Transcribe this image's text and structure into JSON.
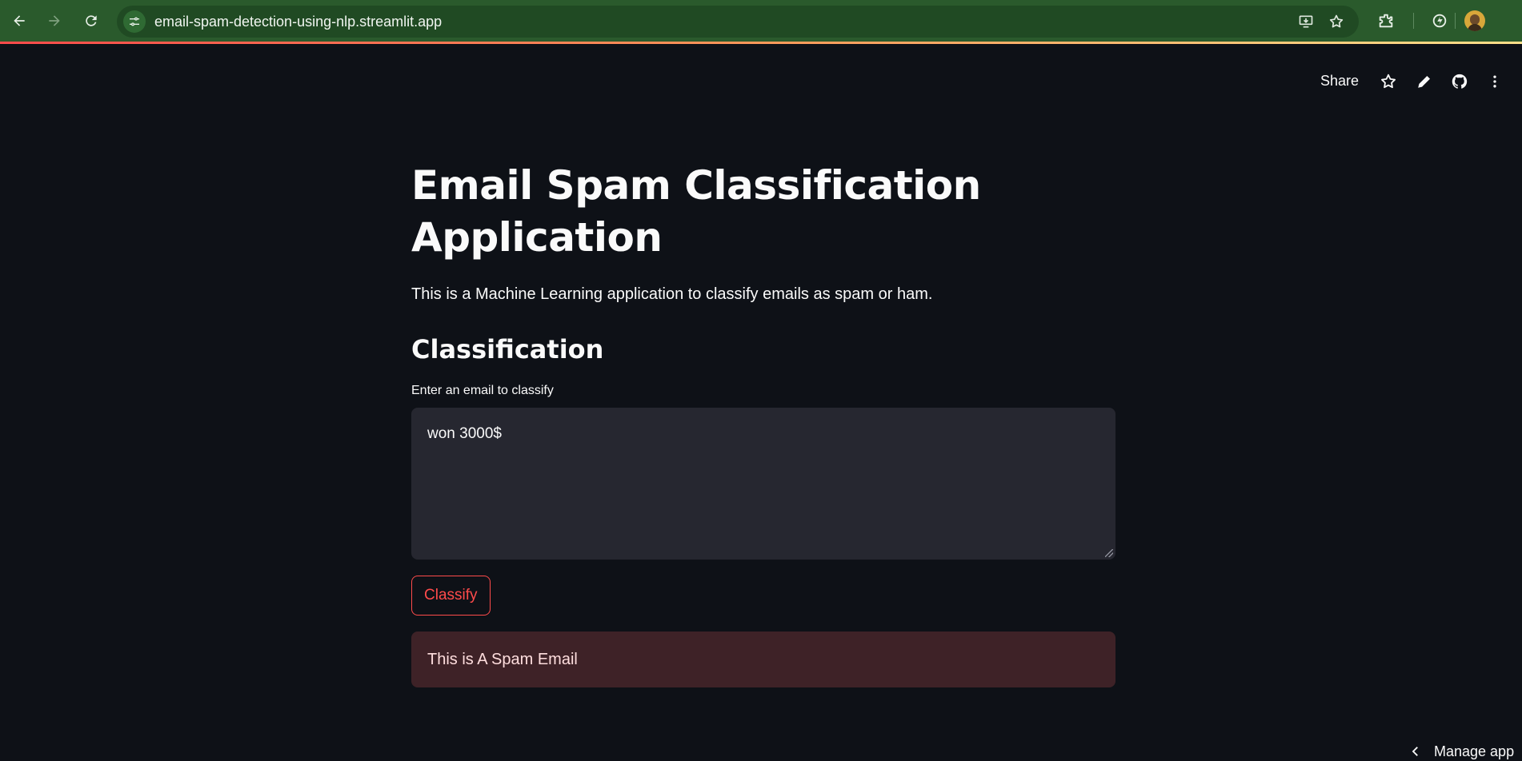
{
  "browser": {
    "url": "email-spam-detection-using-nlp.streamlit.app",
    "icons": {
      "back": "arrow-left-icon",
      "forward": "arrow-right-icon",
      "reload": "reload-icon",
      "site_info": "tune-icon",
      "install": "install-app-icon",
      "bookmark": "star-icon",
      "extensions": "puzzle-icon",
      "performance": "leaf-icon",
      "profile": "avatar"
    }
  },
  "header": {
    "share_label": "Share",
    "icons": [
      "star-icon",
      "pencil-icon",
      "github-icon",
      "more-vertical-icon"
    ]
  },
  "main": {
    "title": "Email Spam Classification Application",
    "description": "This is a Machine Learning application to classify emails as spam or ham.",
    "subheader": "Classification",
    "input_label": "Enter an email to classify",
    "input_value": "won 3000$",
    "button_label": "Classify",
    "result": "This is A Spam Email"
  },
  "footer": {
    "manage_app_label": "Manage app"
  },
  "colors": {
    "background": "#0e1117",
    "browser_bar": "#2a5a2c",
    "primary": "#ff4b4b",
    "input_bg": "#262730",
    "error_bg": "#3e2227"
  }
}
